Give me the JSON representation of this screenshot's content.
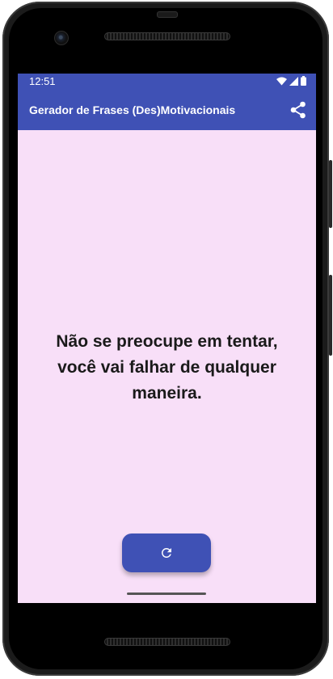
{
  "status_bar": {
    "time": "12:51",
    "icons": [
      "wifi-icon",
      "signal-icon",
      "battery-icon"
    ]
  },
  "app_bar": {
    "title": "Gerador de Frases (Des)Motivacionais",
    "action_icon": "share-icon"
  },
  "main": {
    "quote": "Não se preocupe em tentar, você vai falhar de qualquer maneira.",
    "refresh_icon": "refresh-icon"
  },
  "colors": {
    "primary": "#3f51b5",
    "background": "#f8dff8",
    "text": "#1a1a1a"
  }
}
